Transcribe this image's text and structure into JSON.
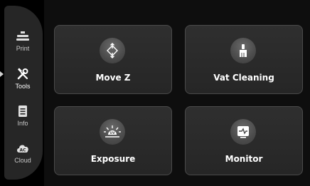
{
  "sidebar": {
    "active_index": 1,
    "items": [
      {
        "label": "Print",
        "icon": "printer-icon"
      },
      {
        "label": "Tools",
        "icon": "tools-icon"
      },
      {
        "label": "Info",
        "icon": "document-icon"
      },
      {
        "label": "Cloud",
        "icon": "cloud-icon"
      }
    ]
  },
  "cards": [
    {
      "label": "Move Z",
      "icon": "move-arrows-icon"
    },
    {
      "label": "Vat Cleaning",
      "icon": "brush-icon"
    },
    {
      "label": "Exposure",
      "icon": "uv-sun-icon",
      "icon_text": "UV"
    },
    {
      "label": "Monitor",
      "icon": "monitor-icon"
    }
  ],
  "colors": {
    "background": "#0e0e0e",
    "card": "#2b2b2b",
    "card_border": "#4a4a4a",
    "icon_circle": "#4f4f4f",
    "text": "#ffffff"
  }
}
